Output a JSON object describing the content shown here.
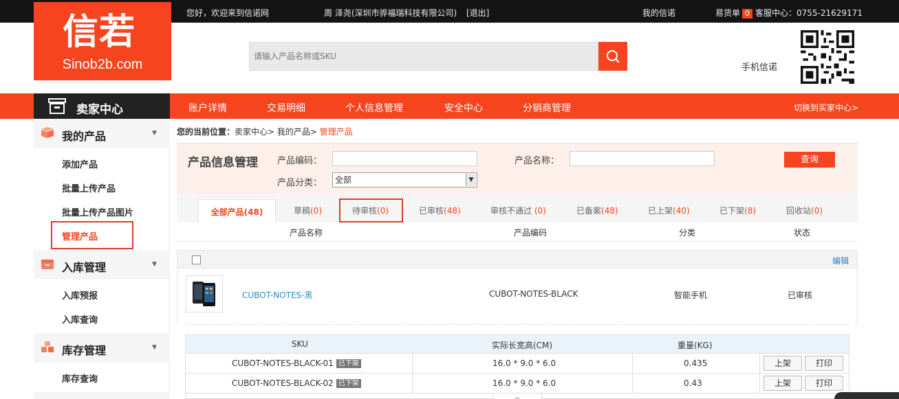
{
  "topbar": {
    "greeting": "您好，欢迎来到信诺网",
    "user": "周 泽尧(深圳市骅福瑞科技有限公司)",
    "logout": "[退出]",
    "my_sinob": "我的信诺",
    "cart_label": "易货单",
    "cart_count": "0",
    "service": "客服中心：0755-21629171"
  },
  "logo": {
    "mark": "信若",
    "sub": "Sinob2b.com"
  },
  "search": {
    "placeholder": "请输入产品名称或SKU",
    "icon": "search-icon"
  },
  "mobile": {
    "label": "手机信诺",
    "icon": "qr-code-icon"
  },
  "nav": {
    "seller_center": "卖家中心",
    "items": [
      "账户详情",
      "交易明细",
      "个人信息管理",
      "安全中心",
      "分销商管理"
    ],
    "switch": "切换到买家中心>"
  },
  "sidebar": {
    "sections": [
      {
        "title": "我的产品",
        "icon": "box-icon",
        "items": [
          "添加产品",
          "批量上传产品",
          "批量上传产品图片",
          "管理产品"
        ]
      },
      {
        "title": "入库管理",
        "icon": "warehouse-icon",
        "items": [
          "入库预报",
          "入库查询"
        ]
      },
      {
        "title": "库存管理",
        "icon": "boxes-icon",
        "items": [
          "库存查询"
        ]
      }
    ]
  },
  "breadcrumb": {
    "prefix": "您的当前位置：",
    "path": "卖家中心> 我的产品> ",
    "current": "管理产品"
  },
  "filter": {
    "title": "产品信息管理",
    "code_label": "产品编码：",
    "name_label": "产品名称：",
    "category_label": "产品分类：",
    "category_value": "全部",
    "query": "查询"
  },
  "tabs": [
    {
      "label": "全部产品",
      "count": "(48)"
    },
    {
      "label": "草稿",
      "count": "(0)"
    },
    {
      "label": "待审核",
      "count": "(0)"
    },
    {
      "label": "已审核",
      "count": "(48)"
    },
    {
      "label": "审核不通过 ",
      "count": "(0)"
    },
    {
      "label": "已备案",
      "count": "(48)"
    },
    {
      "label": "已上架",
      "count": "(40)"
    },
    {
      "label": "已下架",
      "count": "(8)"
    },
    {
      "label": "回收站",
      "count": "(0)"
    }
  ],
  "list_headers": {
    "name": "产品名称",
    "code": "产品编码",
    "category": "分类",
    "status": "状态"
  },
  "product": {
    "edit": "编辑",
    "name": "CUBOT-NOTES-黑",
    "code": "CUBOT-NOTES-BLACK",
    "category": "智能手机",
    "status": "已审核"
  },
  "sku_headers": {
    "sku": "SKU",
    "dims": "实际长宽高(CM)",
    "weight": "重量(KG)"
  },
  "skus": [
    {
      "sku": "CUBOT-NOTES-BLACK-01",
      "badge": "已下架",
      "dims": "16.0 * 9.0 * 6.0",
      "weight": "0.435",
      "btn_on": "上架",
      "btn_print": "打印"
    },
    {
      "sku": "CUBOT-NOTES-BLACK-02",
      "badge": "已下架",
      "dims": "16.0 * 9.0 * 6.0",
      "weight": "0.43",
      "btn_on": "上架",
      "btn_print": "打印"
    }
  ],
  "colors": {
    "accent": "#f5441e",
    "topbar": "#141414",
    "link": "#2b8cc2",
    "highlight": "#e1392d"
  }
}
